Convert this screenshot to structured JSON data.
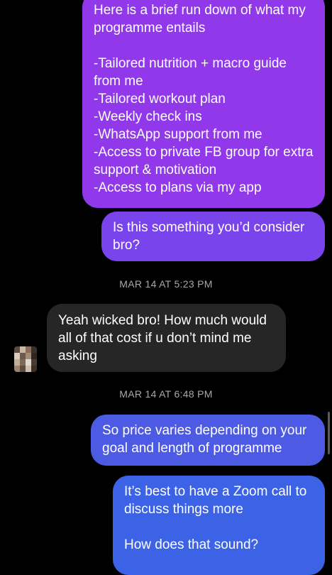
{
  "messages": [
    {
      "text": "Here is a brief run down of what my programme entails\n\n-Tailored nutrition + macro guide from me\n-Tailored workout plan\n-Weekly check ins\n-WhatsApp support from me\n-Access to private FB group for extra support & motivation\n-Access to plans via my app"
    },
    {
      "text": "Is this something you’d consider bro?"
    },
    {
      "timestamp": "MAR 14 AT 5:23 PM"
    },
    {
      "text": "Yeah wicked bro! How much would all of that cost if u don’t mind me asking"
    },
    {
      "timestamp": "MAR 14 AT 6:48 PM"
    },
    {
      "text": "So price varies depending on your goal and length of programme"
    },
    {
      "text": "It’s best to have a Zoom call to discuss things more\n\nHow does that sound?"
    }
  ],
  "colors": {
    "background": "#000000",
    "outgoing_gradient_top": "#9038ea",
    "outgoing_gradient_bottom": "#3c63e6",
    "incoming_bubble": "#262626",
    "timestamp_text": "#a8a8a8"
  },
  "avatar": {
    "icon": "avatar-pixelated",
    "pixel_colors": [
      "#5b4a3f",
      "#c9b9a6",
      "#8a6f5c",
      "#3b3028",
      "#d8cdbf",
      "#6d5a4b",
      "#a38d78",
      "#2f2620",
      "#bfae9a",
      "#7d6a59",
      "#e2d8cc",
      "#4a3b31",
      "#9a8571",
      "#5f4d40",
      "#cdbfae",
      "#3a2e25"
    ]
  }
}
